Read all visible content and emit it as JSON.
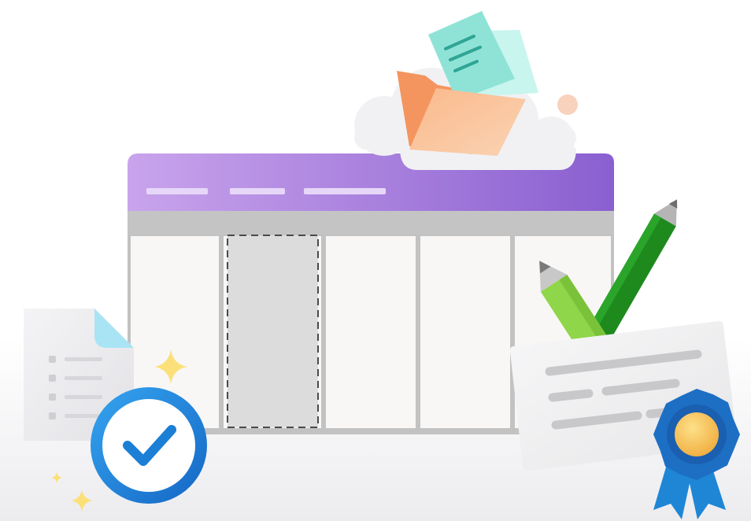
{
  "illustration": {
    "board": {
      "header_color": "#9b72d6",
      "header_placeholder_bars": 3,
      "columns": 5,
      "highlighted_column": 2
    },
    "icons": [
      "folder-icon",
      "cloud-icon",
      "document-icon",
      "checklist-document-icon",
      "check-circle-icon",
      "pencil-icon",
      "certificate-icon",
      "award-ribbon-icon",
      "sparkle-icon"
    ],
    "colors": {
      "accent_purple": "#9b72d6",
      "check_blue": "#1b7fd6",
      "pencil_dark_green": "#1e8a1e",
      "pencil_light_green": "#8fd64a",
      "folder_orange": "#f6a271",
      "document_teal": "#8fe3d6",
      "sparkle_yellow": "#fbe07a",
      "medal_gold": "#f4c35a"
    }
  }
}
